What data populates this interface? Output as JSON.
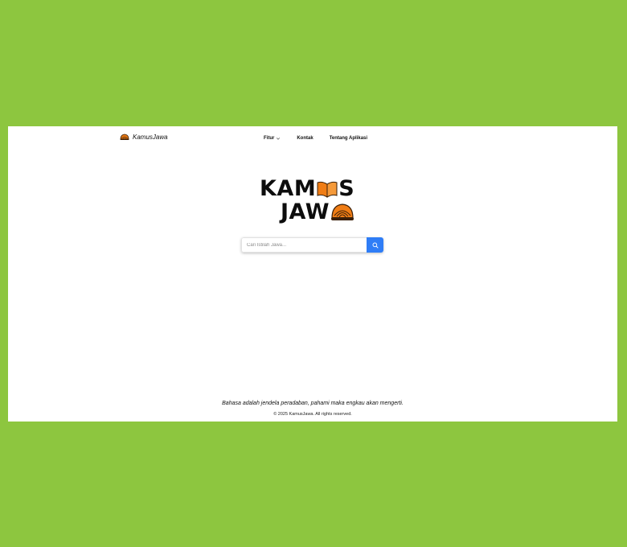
{
  "header": {
    "brand_name": "KamusJawa",
    "brand_icon": "blangkon-icon",
    "nav": [
      {
        "label": "Fitur",
        "has_dropdown": true
      },
      {
        "label": "Kontak"
      },
      {
        "label": "Tentang Aplikasi"
      }
    ]
  },
  "logo": {
    "line1_a": "KAM",
    "line1_b": "S",
    "line2": "JAW",
    "icon_book": "open-book-icon",
    "icon_hat": "blangkon-icon"
  },
  "search": {
    "placeholder": "Cari Istilah Jawa...",
    "value": "",
    "button_icon": "search-icon"
  },
  "footer": {
    "quote": "Bahasa adalah jendela peradaban, pahami maka engkau akan mengerti.",
    "copyright": "© 2025 KamusJawa. All rights reserved."
  },
  "colors": {
    "background": "#8dc63f",
    "accent": "#2f7df6",
    "logo_orange": "#f07d15"
  }
}
